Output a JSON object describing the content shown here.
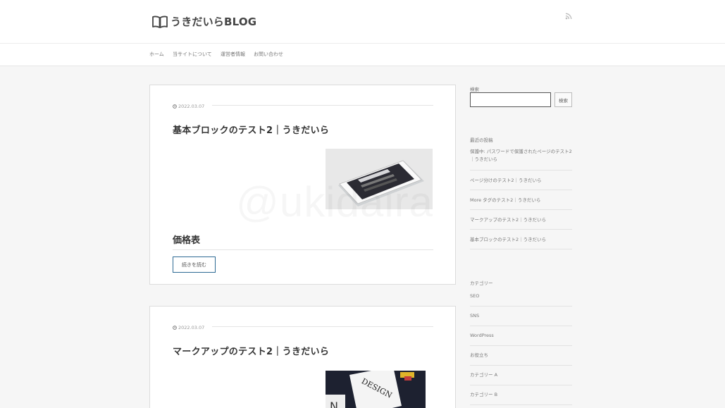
{
  "site": {
    "title": "うきだいらBLOG"
  },
  "nav": [
    "ホーム",
    "当サイトについて",
    "運営者情報",
    "お問い合わせ"
  ],
  "watermark": "@ukidaira",
  "posts": [
    {
      "date": "2022.03.07",
      "title": "基本ブロックのテスト2｜うきだいら",
      "heading": "価格表",
      "read_more": "続きを読む"
    },
    {
      "date": "2022.03.07",
      "title": "マークアップのテスト2｜うきだいら",
      "thumb_text": "DESIGN"
    }
  ],
  "sidebar": {
    "search_label": "検索",
    "search_button": "検索",
    "recent_label": "最近の投稿",
    "recent_posts": [
      "保護中: パスワードで保護されたページのテスト2｜うきだいら",
      "ページ分けのテスト2｜うきだいら",
      "More タグのテスト2｜うきだいら",
      "マークアップのテスト2｜うきだいら",
      "基本ブロックのテスト2｜うきだいら"
    ],
    "category_label": "カテゴリー",
    "categories": [
      "SEO",
      "SNS",
      "WordPress",
      "お役立ち",
      "カテゴリー A",
      "カテゴリー B"
    ]
  },
  "colors": {
    "button_border": "#2d6a94",
    "card_border": "#dcdcdc",
    "background": "#f6f6f6"
  }
}
